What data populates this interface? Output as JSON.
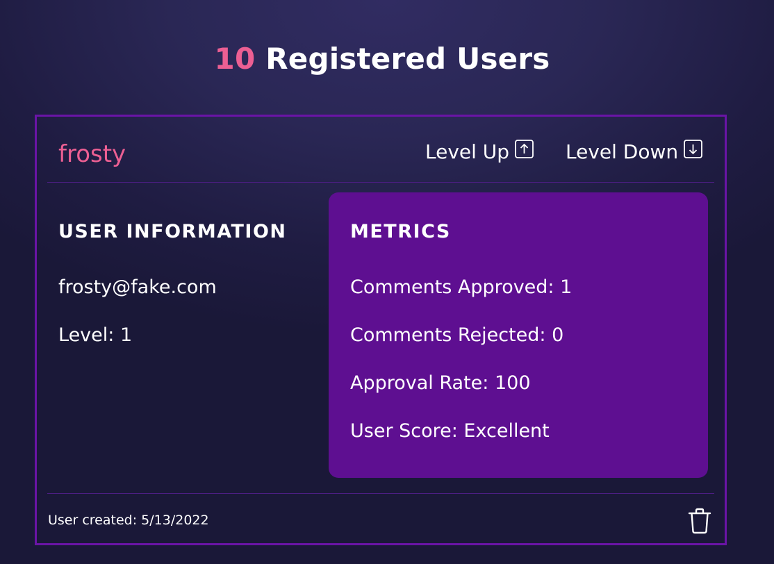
{
  "header": {
    "count": "10",
    "title_rest": " Registered Users"
  },
  "user": {
    "username": "frosty",
    "level_up_label": "Level Up",
    "level_down_label": "Level Down",
    "info_heading": "USER INFORMATION",
    "email": "frosty@fake.com",
    "level": "Level: 1",
    "metrics_heading": "METRICS",
    "metrics": [
      "Comments Approved: 1",
      "Comments Rejected: 0",
      "Approval Rate: 100",
      "User Score: Excellent"
    ],
    "created": "User created: 5/13/2022"
  },
  "icons": {
    "level_up": "arrow-up-box-icon",
    "level_down": "arrow-down-box-icon",
    "delete": "trash-icon"
  },
  "colors": {
    "accent": "#ec5f93",
    "card_border": "#6a14a6",
    "metrics_bg": "#5e0f91"
  }
}
